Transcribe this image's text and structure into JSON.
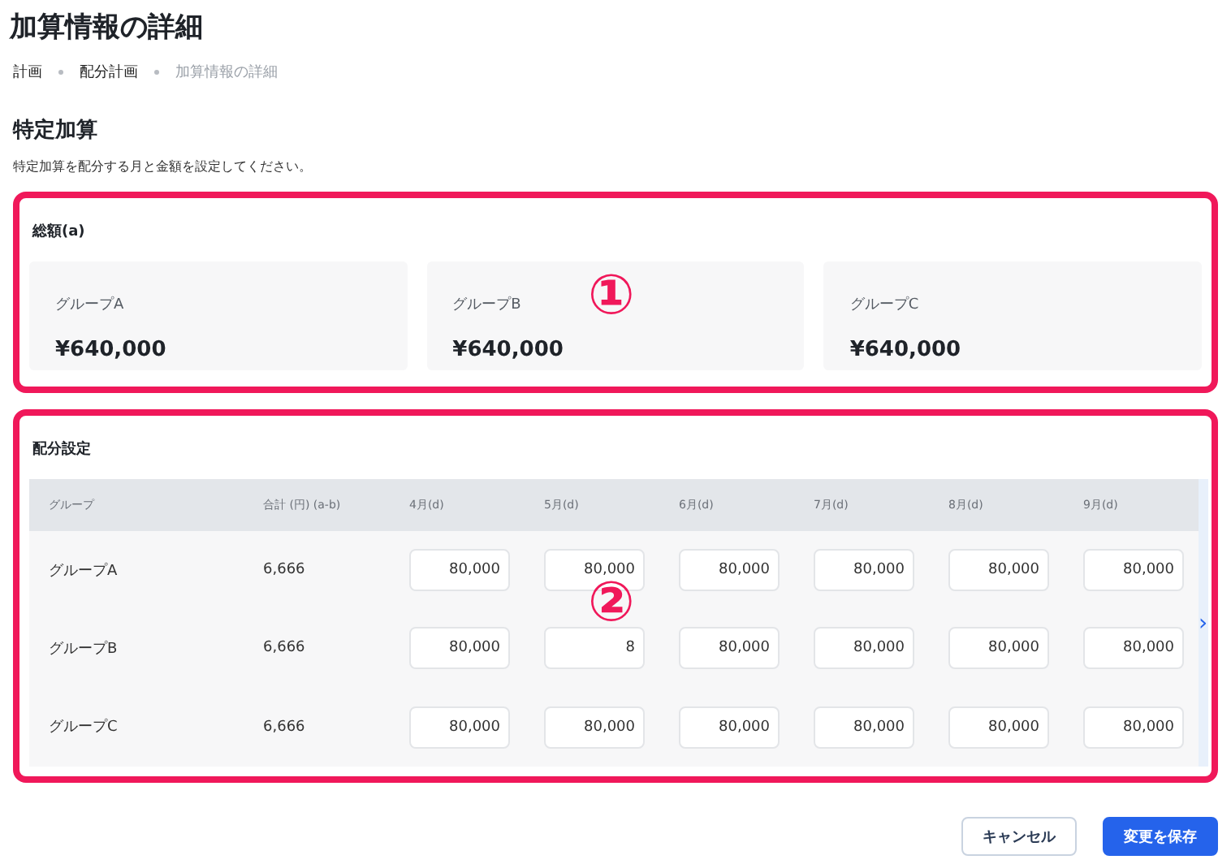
{
  "page": {
    "title": "加算情報の詳細"
  },
  "breadcrumb": [
    {
      "label": "計画",
      "current": false
    },
    {
      "label": "配分計画",
      "current": false
    },
    {
      "label": "加算情報の詳細",
      "current": true
    }
  ],
  "section": {
    "title": "特定加算",
    "description": "特定加算を配分する月と金額を設定してください。"
  },
  "totals": {
    "title": "総額(a)",
    "annotation": "①",
    "cards": [
      {
        "label": "グループA",
        "amount": "¥640,000"
      },
      {
        "label": "グループB",
        "amount": "¥640,000"
      },
      {
        "label": "グループC",
        "amount": "¥640,000"
      }
    ]
  },
  "allocation": {
    "title": "配分設定",
    "annotation": "②",
    "table": {
      "columns": [
        "グループ",
        "合計 (円) (a-b)",
        "4月(d)",
        "5月(d)",
        "6月(d)",
        "7月(d)",
        "8月(d)",
        "9月(d)"
      ],
      "rows": [
        {
          "group": "グループA",
          "total": "6,666",
          "values": [
            "80,000",
            "80,000",
            "80,000",
            "80,000",
            "80,000",
            "80,000"
          ]
        },
        {
          "group": "グループB",
          "total": "6,666",
          "values": [
            "80,000",
            "8",
            "80,000",
            "80,000",
            "80,000",
            "80,000"
          ]
        },
        {
          "group": "グループC",
          "total": "6,666",
          "values": [
            "80,000",
            "80,000",
            "80,000",
            "80,000",
            "80,000",
            "80,000"
          ]
        }
      ]
    },
    "scroll_next": "›"
  },
  "buttons": [
    {
      "label": "キャンセル",
      "kind": "secondary"
    },
    {
      "label": "変更を保存",
      "kind": "primary"
    }
  ]
}
